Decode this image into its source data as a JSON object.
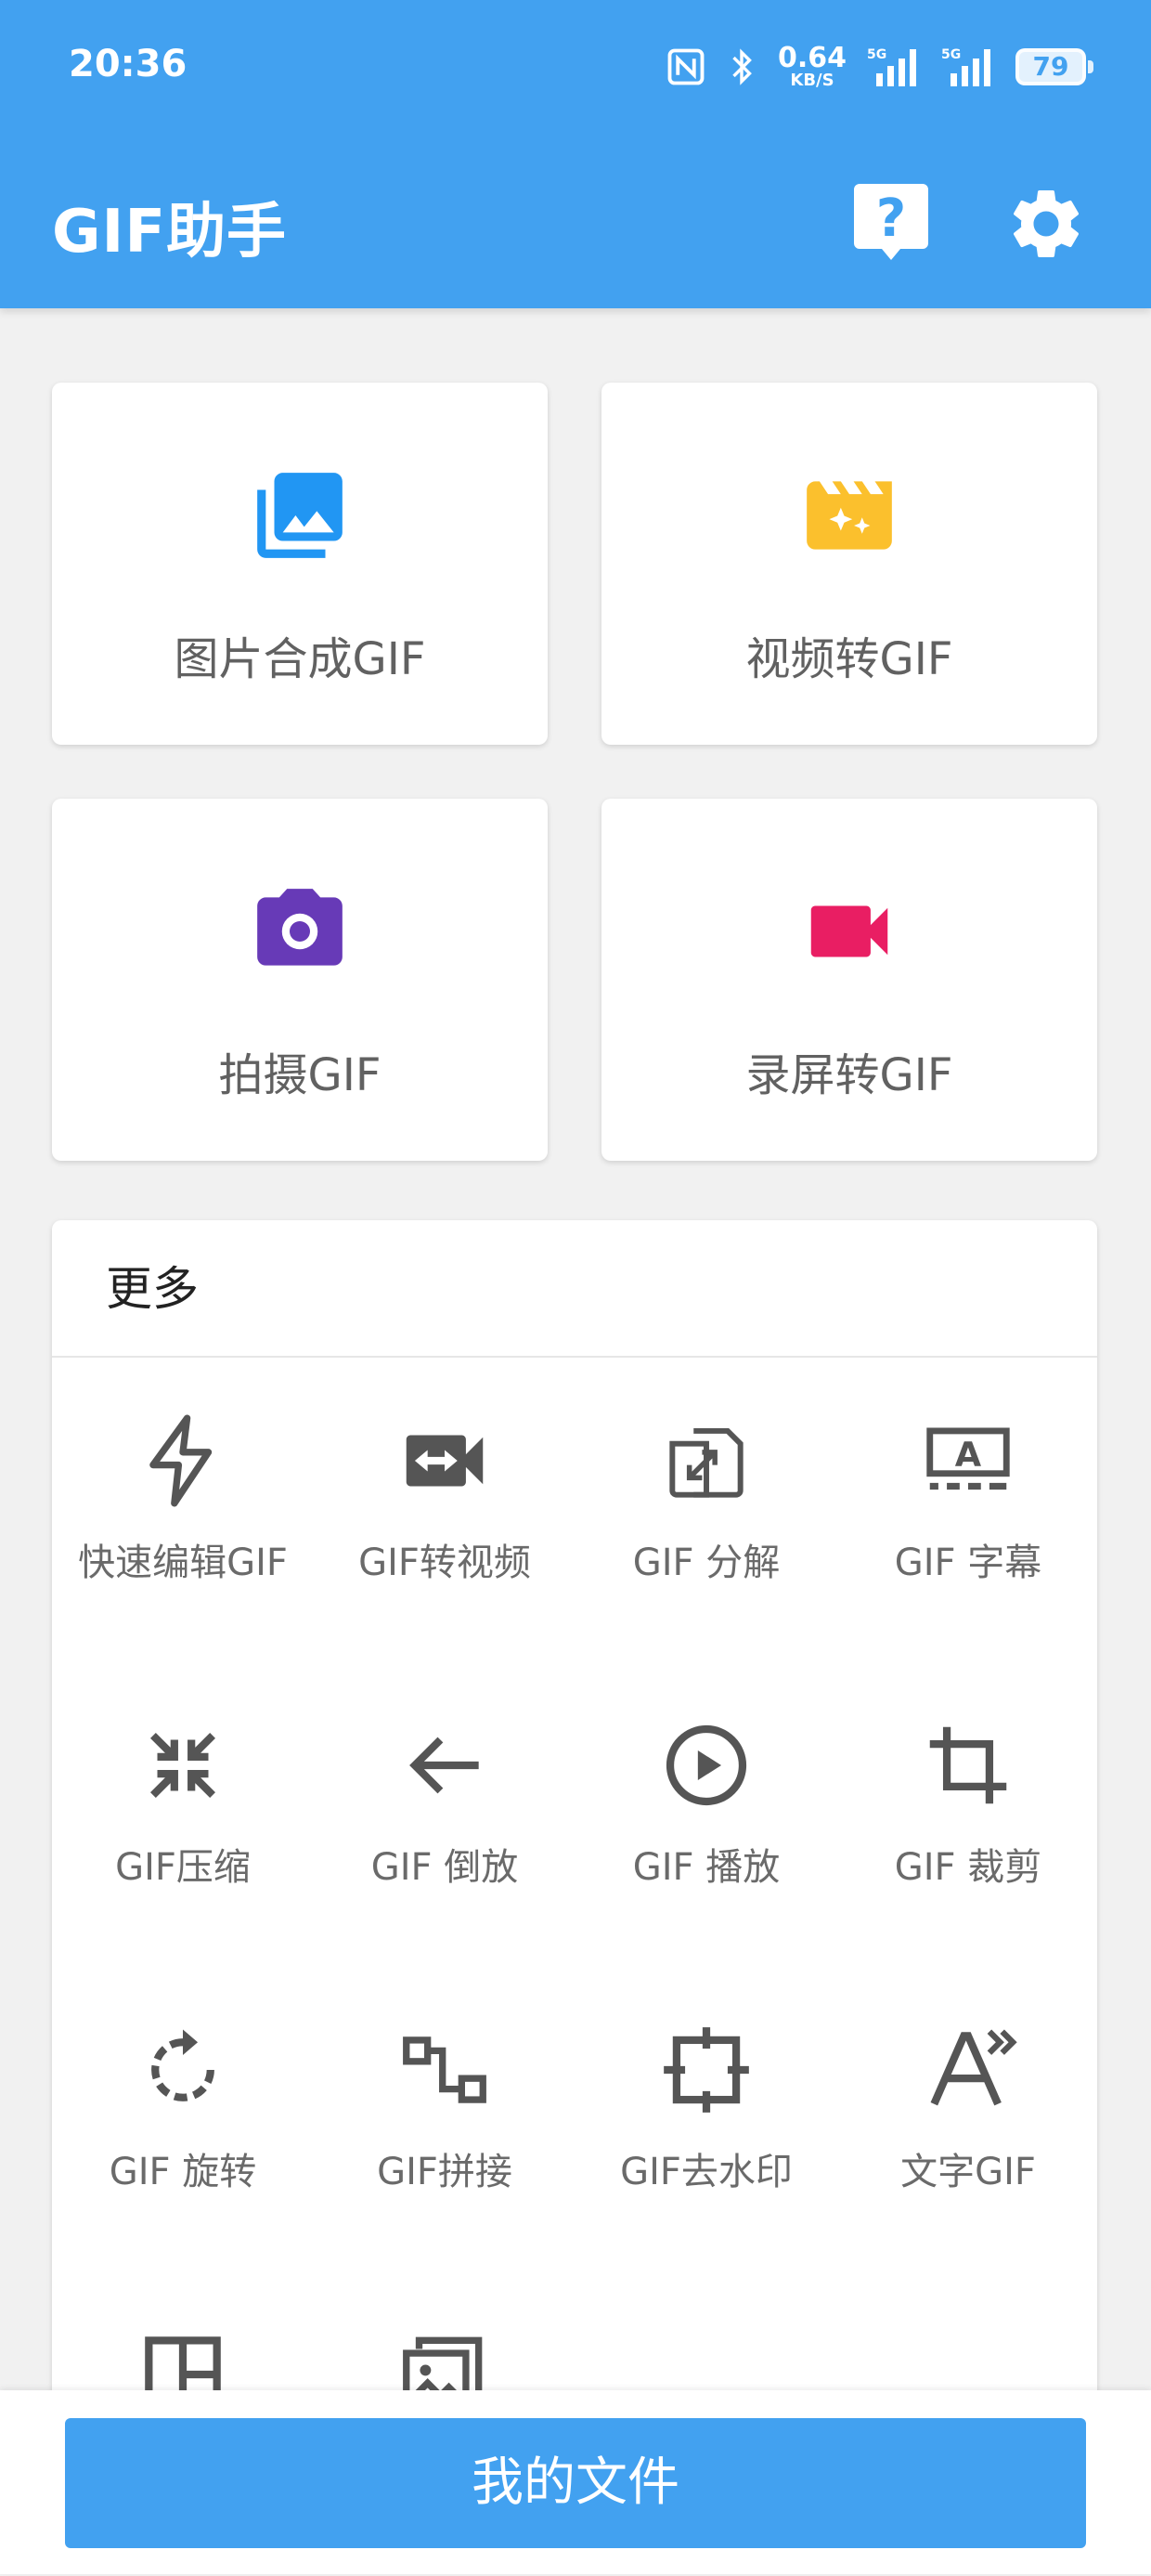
{
  "status_bar": {
    "time": "20:36",
    "net_speed_value": "0.64",
    "net_speed_unit": "KB/S",
    "sim1_label": "5G",
    "sim2_label": "5G",
    "battery_level": "79"
  },
  "app_bar": {
    "title": "GIF助手",
    "help_icon": "help-icon",
    "settings_icon": "gear-icon"
  },
  "features": [
    {
      "label": "图片合成GIF",
      "icon": "photo-library-icon",
      "color": "#2196f3"
    },
    {
      "label": "视频转GIF",
      "icon": "movie-clapper-icon",
      "color": "#fbc02d"
    },
    {
      "label": "拍摄GIF",
      "icon": "camera-icon",
      "color": "#673ab7"
    },
    {
      "label": "录屏转GIF",
      "icon": "videocam-icon",
      "color": "#e91e63"
    }
  ],
  "more": {
    "title": "更多",
    "tools": [
      {
        "label": "快速编辑GIF",
        "icon": "bolt-icon"
      },
      {
        "label": "GIF转视频",
        "icon": "video-convert-icon"
      },
      {
        "label": "GIF 分解",
        "icon": "file-split-icon"
      },
      {
        "label": "GIF 字幕",
        "icon": "subtitles-icon"
      },
      {
        "label": "GIF压缩",
        "icon": "compress-icon"
      },
      {
        "label": "GIF 倒放",
        "icon": "arrow-back-icon"
      },
      {
        "label": "GIF 播放",
        "icon": "play-circle-icon"
      },
      {
        "label": "GIF 裁剪",
        "icon": "crop-icon"
      },
      {
        "label": "GIF 旋转",
        "icon": "rotate-icon"
      },
      {
        "label": "GIF拼接",
        "icon": "join-icon"
      },
      {
        "label": "GIF去水印",
        "icon": "remove-watermark-icon"
      },
      {
        "label": "文字GIF",
        "icon": "text-gif-icon"
      },
      {
        "label": "",
        "icon": "layout-icon"
      },
      {
        "label": "",
        "icon": "images-icon"
      }
    ]
  },
  "bottom": {
    "my_files_label": "我的文件"
  }
}
